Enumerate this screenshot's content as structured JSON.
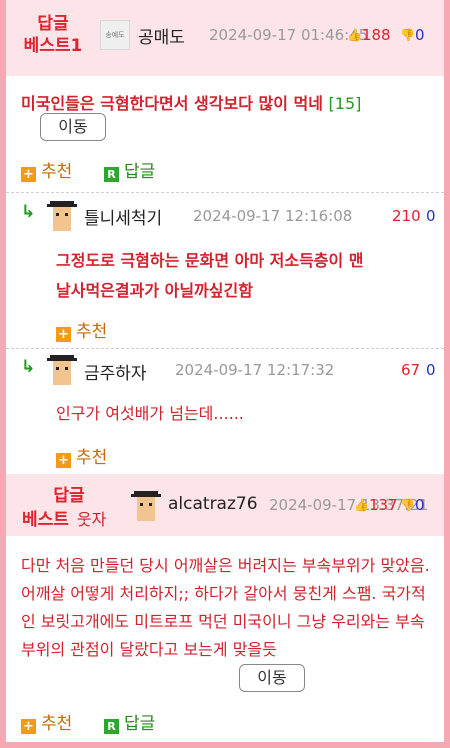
{
  "best1": {
    "label": "답글\n베스트1",
    "label_line1": "답글",
    "label_line2": "베스트1",
    "avatar_text": "송예도",
    "nickname": "공매도",
    "date": "2024-09-17 01:46:45",
    "upvotes": "188",
    "downvotes": "0",
    "title": "미국인들은 극혐한다면서 생각보다 많이 먹네",
    "comment_count": "[15]",
    "move_label": "이동",
    "recommend_label": "추천",
    "reply_label": "답글"
  },
  "replies": [
    {
      "nickname": "틀니세척기",
      "date": "2024-09-17 12:16:08",
      "upvotes": "210",
      "downvotes": "0",
      "text_line1": "그정도로 극혐하는 문화면 아마 저소득층이 맨",
      "text_line2": "날사먹은결과가 아닐까싶긴함",
      "recommend_label": "추천"
    },
    {
      "nickname": "금주하자",
      "date": "2024-09-17 12:17:32",
      "upvotes": "67",
      "downvotes": "0",
      "text_line1": "인구가 여섯배가 넘는데......",
      "recommend_label": "추천"
    }
  ],
  "best2": {
    "label_line1": "답글",
    "label_line2": "베스트",
    "badge": "웃자",
    "nickname": "alcatraz76",
    "date": "2024-09-17 13:37:21",
    "upvotes": "137",
    "downvotes": "0",
    "body": "다만 처음 만들던 당시 어깨살은 버려지는 부속부위가 맞았음. 어깨살 어떻게 처리하지;; 하다가 갈아서 뭉친게 스팸. 국가적인 보릿고개에도 미트로프 먹던 미국이니 그냥 우리와는 부속부위의 관점이 달랐다고 보는게 맞을듯",
    "move_label": "이동",
    "recommend_label": "추천",
    "reply_label": "답글"
  },
  "colors": {
    "best_bg": "#fde4e8",
    "frame": "#f4a9b3",
    "accent_red": "#d2222e",
    "down_blue": "#2432c4",
    "plus_orange": "#f39a1c",
    "reply_green": "#2fa52f"
  }
}
